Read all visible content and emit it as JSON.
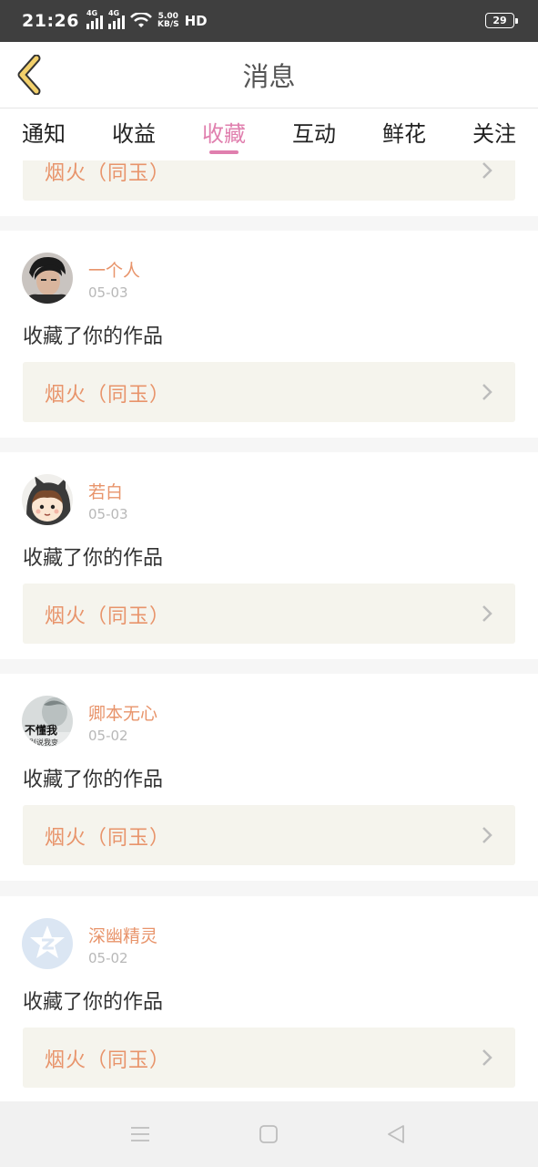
{
  "status_bar": {
    "time": "21:26",
    "network_1": "4G",
    "network_2": "4G",
    "speed_value": "5.00",
    "speed_unit": "KB/S",
    "hd": "HD",
    "battery": "29"
  },
  "header": {
    "title": "消息"
  },
  "tabs": [
    {
      "label": "通知",
      "active": false
    },
    {
      "label": "收益",
      "active": false
    },
    {
      "label": "收藏",
      "active": true
    },
    {
      "label": "互动",
      "active": false
    },
    {
      "label": "鲜花",
      "active": false
    },
    {
      "label": "关注",
      "active": false
    }
  ],
  "partial_card": {
    "work_title": "烟火（同玉）"
  },
  "items": [
    {
      "username": "一个人",
      "date": "05-03",
      "action": "收藏了你的作品",
      "work_title": "烟火（同玉）",
      "avatar": "person-photo"
    },
    {
      "username": "若白",
      "date": "05-03",
      "action": "收藏了你的作品",
      "work_title": "烟火（同玉）",
      "avatar": "cartoon-bear-hood"
    },
    {
      "username": "卿本无心",
      "date": "05-02",
      "action": "收藏了你的作品",
      "work_title": "烟火（同玉）",
      "avatar": "text-meme",
      "avatar_text": "不懂我",
      "avatar_subtext": "别说我变"
    },
    {
      "username": "深幽精灵",
      "date": "05-02",
      "action": "收藏了你的作品",
      "work_title": "烟火（同玉）",
      "avatar": "qzone-default"
    }
  ],
  "colors": {
    "accent": "#e07fae",
    "work_text": "#e8946b",
    "work_bg": "#f5f4ed",
    "status_bg": "#3f3f3f",
    "back_icon": "#f2d06b"
  }
}
